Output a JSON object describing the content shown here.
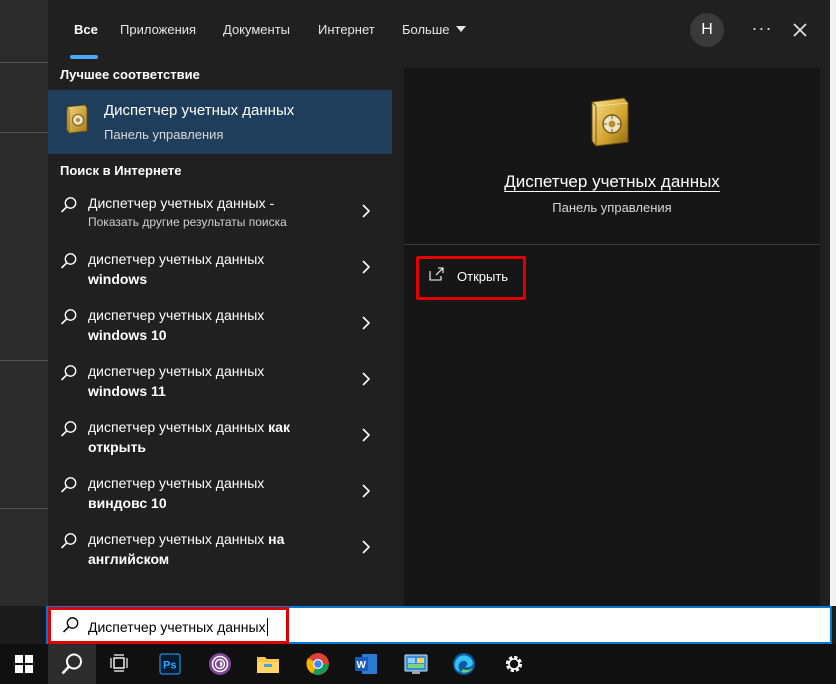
{
  "tabs": [
    {
      "label": "Все",
      "active": true
    },
    {
      "label": "Приложения"
    },
    {
      "label": "Документы"
    },
    {
      "label": "Интернет"
    },
    {
      "label": "Больше"
    }
  ],
  "avatar_letter": "Н",
  "more_label": "···",
  "best_match": {
    "heading": "Лучшее соответствие",
    "title": "Диспетчер учетных данных",
    "subtitle": "Панель управления",
    "icon": "credential-manager-safe-icon"
  },
  "web_search": {
    "heading": "Поиск в Интернете",
    "items": [
      {
        "normal": "Диспетчер учетных данных -",
        "bold": "",
        "sub": "Показать другие результаты поиска"
      },
      {
        "normal": "диспетчер учетных данных",
        "bold": "windows"
      },
      {
        "normal": "диспетчер учетных данных",
        "bold": "windows 10"
      },
      {
        "normal": "диспетчер учетных данных",
        "bold": "windows 11"
      },
      {
        "normal": "диспетчер учетных данных",
        "bold": "как открыть"
      },
      {
        "normal": "диспетчер учетных данных",
        "bold": "виндовс 10"
      },
      {
        "normal": "диспетчер учетных данных",
        "bold": "на английском"
      }
    ]
  },
  "preview": {
    "title": "Диспетчер учетных данных",
    "subtitle": "Панель управления",
    "action_label": "Открыть"
  },
  "search": {
    "value": "Диспетчер учетных данных"
  },
  "taskbar": {
    "apps": [
      "windows-start-icon",
      "search-icon",
      "task-view-icon",
      "photoshop-icon",
      "tor-browser-icon",
      "file-explorer-icon",
      "chrome-icon",
      "word-icon",
      "control-panel-icon",
      "edge-icon",
      "settings-icon"
    ],
    "photoshop_text": "Ps",
    "word_text": "W"
  },
  "colors": {
    "accent": "#0078d7",
    "selection": "#1f3e5b",
    "highlight_box": "#e00000"
  }
}
